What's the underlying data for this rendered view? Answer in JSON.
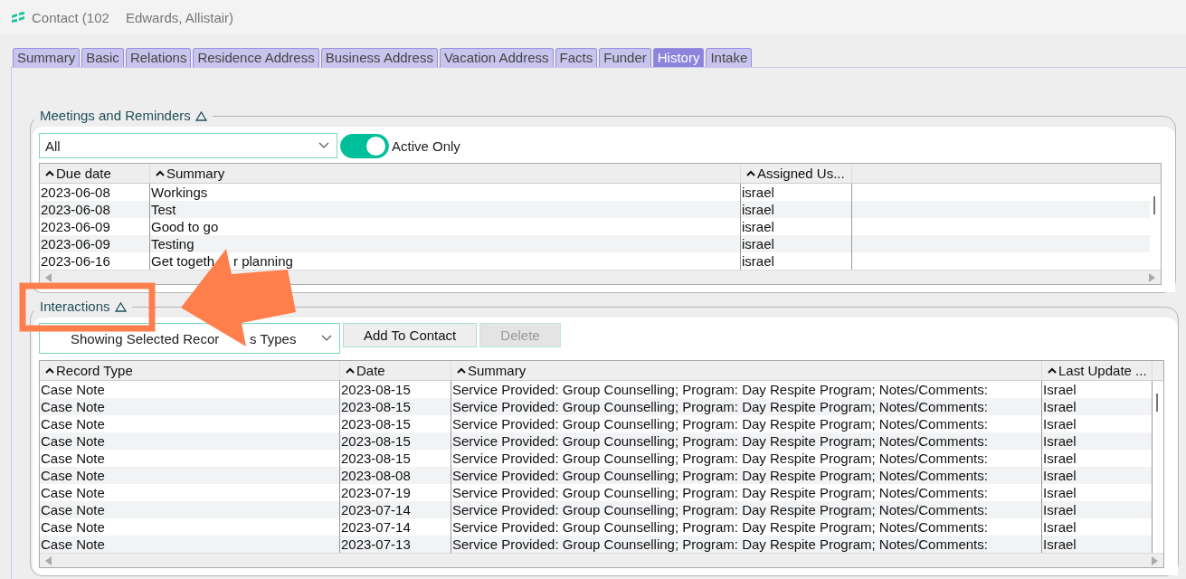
{
  "window": {
    "title": "Contact (102",
    "subtitle": "Edwards, Allistair)"
  },
  "tabs": [
    {
      "label": "Summary",
      "selected": false
    },
    {
      "label": "Basic",
      "selected": false
    },
    {
      "label": "Relations",
      "selected": false
    },
    {
      "label": "Residence Address",
      "selected": false
    },
    {
      "label": "Business Address",
      "selected": false
    },
    {
      "label": "Vacation Address",
      "selected": false
    },
    {
      "label": "Facts",
      "selected": false
    },
    {
      "label": "Funder",
      "selected": false
    },
    {
      "label": "History",
      "selected": true
    },
    {
      "label": "Intake",
      "selected": false
    }
  ],
  "meetings": {
    "title": "Meetings and Reminders",
    "filter": {
      "value": "All"
    },
    "toggle": {
      "label": "Active Only",
      "on": true
    },
    "table": {
      "columns": [
        "Due date",
        "Summary",
        "Assigned Us..."
      ],
      "rows": [
        [
          "2023-06-08",
          "Workings",
          "israel"
        ],
        [
          "2023-06-08",
          "Test",
          "israel"
        ],
        [
          "2023-06-09",
          "Good to go",
          "israel"
        ],
        [
          "2023-06-09",
          "Testing",
          "israel"
        ],
        [
          "2023-06-16",
          [
            "Get togeth",
            "r planning"
          ],
          "israel"
        ]
      ]
    }
  },
  "interactions": {
    "title": "Interactions",
    "filter": {
      "value": [
        "Showing Selected Recor",
        "s Types"
      ]
    },
    "buttons": [
      {
        "label": "Add To Contact",
        "disabled": false
      },
      {
        "label": "Delete",
        "disabled": true
      }
    ],
    "table": {
      "columns": [
        "Record Type",
        "Date",
        "Summary",
        "Last Update ..."
      ],
      "rows": [
        [
          "Case Note",
          "2023-08-15",
          "Service Provided: Group Counselling; Program: Day Respite Program; Notes/Comments:",
          "Israel"
        ],
        [
          "Case Note",
          "2023-08-15",
          "Service Provided: Group Counselling; Program: Day Respite Program; Notes/Comments:",
          "Israel"
        ],
        [
          "Case Note",
          "2023-08-15",
          "Service Provided: Group Counselling; Program: Day Respite Program; Notes/Comments:",
          "Israel"
        ],
        [
          "Case Note",
          "2023-08-15",
          "Service Provided: Group Counselling; Program: Day Respite Program; Notes/Comments:",
          "Israel"
        ],
        [
          "Case Note",
          "2023-08-15",
          "Service Provided: Group Counselling; Program: Day Respite Program; Notes/Comments:",
          "Israel"
        ],
        [
          "Case Note",
          "2023-08-08",
          "Service Provided: Group Counselling; Program: Day Respite Program; Notes/Comments:",
          "Israel"
        ],
        [
          "Case Note",
          "2023-07-19",
          "Service Provided: Group Counselling; Program: Day Respite Program; Notes/Comments:",
          "Israel"
        ],
        [
          "Case Note",
          "2023-07-14",
          "Service Provided: Group Counselling; Program: Day Respite Program; Notes/Comments:",
          "Israel"
        ],
        [
          "Case Note",
          "2023-07-14",
          "Service Provided: Group Counselling; Program: Day Respite Program; Notes/Comments:",
          "Israel"
        ],
        [
          "Case Note",
          "2023-07-13",
          "Service Provided: Group Counselling; Program: Day Respite Program; Notes/Comments:",
          "Israel"
        ]
      ]
    }
  }
}
